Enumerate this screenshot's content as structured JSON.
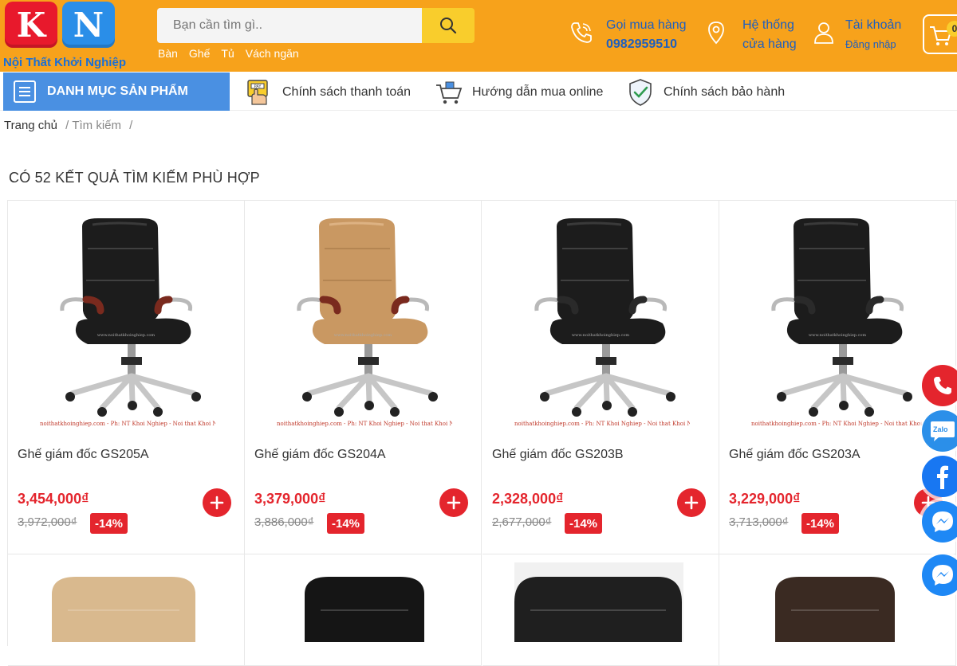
{
  "logo": {
    "letters": [
      "K",
      "N"
    ],
    "tagline": "Nội Thất Khởi Nghiệp"
  },
  "search": {
    "placeholder": "Bạn cần tìm gì..",
    "icon": "search-icon"
  },
  "quick_links": [
    "Bàn",
    "Ghế",
    "Tủ",
    "Vách ngăn"
  ],
  "header": {
    "phone": {
      "label": "Gọi mua hàng",
      "number": "0982959510",
      "icon": "phone-icon"
    },
    "stores": {
      "line1": "Hệ thống",
      "line2": "cửa hàng",
      "icon": "location-pin-icon"
    },
    "account": {
      "label": "Tài khoản",
      "sub": "Đăng nhập",
      "icon": "user-icon"
    },
    "cart": {
      "count": "0",
      "icon": "cart-icon"
    }
  },
  "nav": {
    "category_label": "DANH MỤC SẢN PHẨM",
    "links": [
      "Chính sách thanh toán",
      "Hướng dẫn mua online",
      "Chính sách bảo hành"
    ]
  },
  "breadcrumb": {
    "home": "Trang chủ",
    "current": "Tìm kiếm",
    "sep": "/"
  },
  "results_title": "CÓ 52 KẾT QUẢ TÌM KIẾM PHÙ HỢP",
  "watermark": "noithatkhoinghiep.com - Ph: NT Khoi Nghiep - Noi that Khoi Nghiep",
  "watermark_seat": "www.noithatkhoinghiep.com",
  "products": [
    {
      "name": "Ghế giám đốc GS205A",
      "price": "3,454,000₫",
      "old_price": "3,972,000₫",
      "discount": "-14%",
      "color": "black",
      "arm": "wood"
    },
    {
      "name": "Ghế giám đốc GS204A",
      "price": "3,379,000₫",
      "old_price": "3,886,000₫",
      "discount": "-14%",
      "color": "tan",
      "arm": "wood"
    },
    {
      "name": "Ghế giám đốc GS203B",
      "price": "2,328,000₫",
      "old_price": "2,677,000₫",
      "discount": "-14%",
      "color": "black",
      "arm": "metal"
    },
    {
      "name": "Ghế giám đốc GS203A",
      "price": "3,229,000₫",
      "old_price": "3,713,000₫",
      "discount": "-14%",
      "color": "black",
      "arm": "metal"
    }
  ],
  "colors": {
    "header_bg": "#f7a21b",
    "category_bg": "#4a90e2",
    "price_red": "#e4252d",
    "search_btn": "#f9cd2c"
  },
  "float_buttons": [
    "phone-icon",
    "zalo-icon",
    "facebook-icon",
    "messenger-icon",
    "messenger-icon"
  ],
  "zalo_label": "Zalo"
}
